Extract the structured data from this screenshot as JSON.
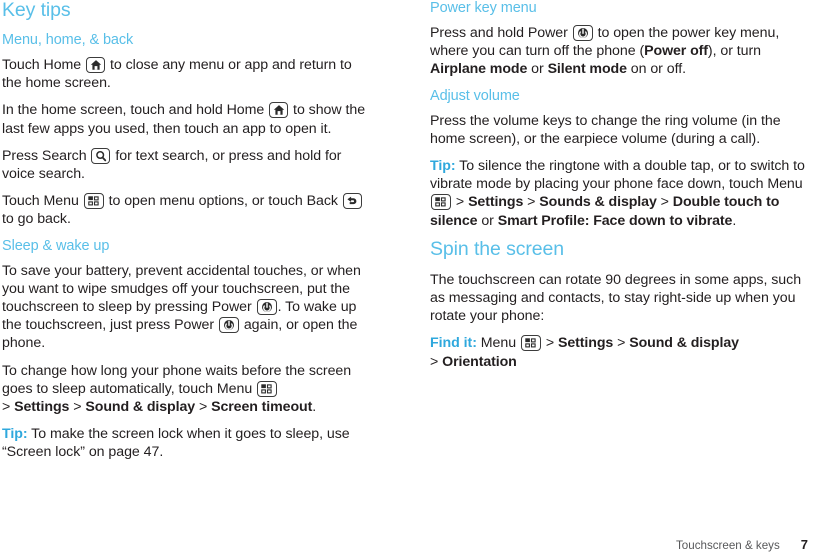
{
  "document": {
    "footer": {
      "chapter": "Touchscreen & keys",
      "page_number": "7"
    },
    "accent_color": "#59bfe8",
    "tip_color": "#2fa8dd",
    "text_color": "#231f20"
  },
  "left_column": {
    "section_title": "Key tips",
    "subsection_1": {
      "title": "Menu, home, & back",
      "p1_a": "Touch Home ",
      "p1_icon": "home-key-icon",
      "p1_b": " to close any menu or app and return to the home screen.",
      "p2_a": "In the home screen, touch and hold Home ",
      "p2_icon": "home-key-icon",
      "p2_b": " to show the last few apps you used, then touch an app to open it.",
      "p3_a": "Press Search ",
      "p3_icon": "search-key-icon",
      "p3_b": " for text search, or press and hold for voice search.",
      "p4_a": "Touch Menu ",
      "p4_icon": "menu-key-icon",
      "p4_b": " to open menu options, or touch Back ",
      "p4_icon2": "back-key-icon",
      "p4_c": " to go back."
    },
    "subsection_2": {
      "title": "Sleep & wake up",
      "p1_a": "To save your battery, prevent accidental touches, or when you want to wipe smudges off your touchscreen, put the touchscreen to sleep by pressing Power ",
      "p1_icon": "power-key-icon",
      "p1_b": ". To wake up the touchscreen, just press Power ",
      "p1_icon2": "power-key-icon",
      "p1_c": " again, or open the phone.",
      "p2_a": "To change how long your phone waits before the screen goes to sleep automatically, touch Menu ",
      "p2_icon": "menu-key-icon",
      "p2_sep1": ">",
      "p2_b1": "Settings",
      "p2_sep2": ">",
      "p2_b2": "Sound & display",
      "p2_sep3": ">",
      "p2_b3": "Screen timeout",
      "p2_end": ".",
      "tip_label": "Tip:",
      "tip_text": " To make the screen lock when it goes to sleep, use “Screen lock” on page 47."
    }
  },
  "right_column": {
    "subsection_1": {
      "title": "Power key menu",
      "p1_a": "Press and hold Power ",
      "p1_icon": "power-key-icon",
      "p1_b": " to open the power key menu, where you can turn off the phone (",
      "p1_b1": "Power off",
      "p1_c": "), or turn ",
      "p1_b2": "Airplane mode",
      "p1_d": " or ",
      "p1_b3": "Silent mode",
      "p1_e": " on or off."
    },
    "subsection_2": {
      "title": "Adjust volume",
      "p1": "Press the volume keys to change the ring volume (in the home screen), or the earpiece volume (during a call).",
      "tip_label": "Tip:",
      "tip_a": " To silence the ringtone with a double tap, or to switch to vibrate mode by placing your phone face down, touch Menu ",
      "tip_icon": "menu-key-icon",
      "tip_sep1": ">",
      "tip_b1": "Settings",
      "tip_sep2": ">",
      "tip_b2": "Sounds & display",
      "tip_sep3": ">",
      "tip_b3": "Double touch to silence",
      "tip_or": " or ",
      "tip_b4": "Smart Profile: Face down to vibrate",
      "tip_end": "."
    },
    "section_title": "Spin the screen",
    "subsection_3": {
      "p1": "The touchscreen can rotate 90 degrees in some apps, such as messaging and contacts, to stay right-side up when you rotate your phone:",
      "findit_label": "Find it:",
      "findit_menu": " Menu ",
      "findit_icon": "menu-key-icon",
      "findit_sep1": ">",
      "findit_b1": "Settings",
      "findit_sep2": ">",
      "findit_b2": "Sound & display",
      "findit_sep3": ">",
      "findit_b3": "Orientation"
    }
  }
}
